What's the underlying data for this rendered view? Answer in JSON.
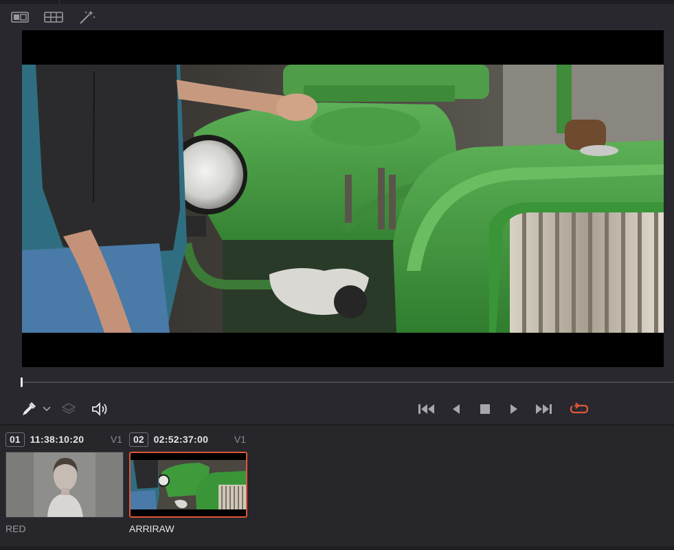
{
  "toolbar": {
    "icons": [
      "split-wipe-icon",
      "gallery-grid-icon",
      "magic-wand-icon"
    ]
  },
  "viewer": {
    "image": "green-tractor-frame"
  },
  "playhead": {
    "position_fraction": 0.0
  },
  "controls": {
    "left_icons": [
      "eyedropper-icon",
      "dropdown-arrow-icon",
      "layers-icon",
      "speaker-icon"
    ],
    "transport_icons": [
      "skip-to-start-icon",
      "play-reverse-icon",
      "stop-icon",
      "play-forward-icon",
      "skip-to-end-icon",
      "loop-icon"
    ],
    "loop_color": "#e2573a"
  },
  "clips": [
    {
      "number": "01",
      "timecode": "11:38:10:20",
      "track": "V1",
      "name": "RED",
      "selected": false
    },
    {
      "number": "02",
      "timecode": "02:52:37:00",
      "track": "V1",
      "name": "ARRIRAW",
      "selected": true
    }
  ],
  "colors": {
    "accent": "#e2573a",
    "panel": "#28282e",
    "tractor_green": "#3f9a3c"
  }
}
